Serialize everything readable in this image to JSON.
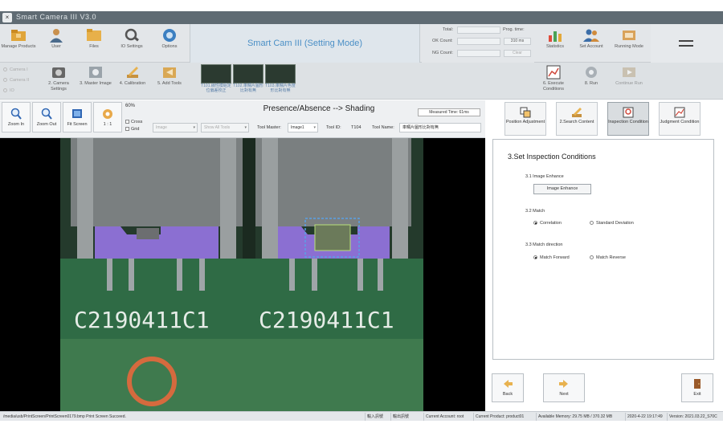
{
  "window": {
    "title": "Smart Camera III   V3.0",
    "close_glyph": "×"
  },
  "toolbar1": {
    "items": [
      {
        "label": "Manage Products",
        "icon": "folder-icon"
      },
      {
        "label": "User",
        "icon": "user-icon"
      },
      {
        "label": "Files",
        "icon": "files-folder-icon"
      },
      {
        "label": "IO Settings",
        "icon": "io-settings-icon"
      },
      {
        "label": "Options",
        "icon": "options-icon"
      }
    ],
    "mode_title": "Smart Cam III   (Setting Mode)",
    "total_label": "Total:",
    "ok_label": "OK Count:",
    "ng_label": "NG Count:",
    "prog_time_label": "Prog. time:",
    "prog_time_value": "310 ms",
    "clear_label": "Clear",
    "right_items": [
      {
        "label": "Statistics",
        "icon": "statistics-icon"
      },
      {
        "label": "Set Account",
        "icon": "set-account-icon"
      },
      {
        "label": "Running Mode",
        "icon": "running-mode-icon"
      }
    ]
  },
  "toolbar2": {
    "cameras": [
      "Camera I",
      "Camera II",
      "IO"
    ],
    "items": [
      {
        "label": "2. Camera Settings",
        "icon": "camera-icon"
      },
      {
        "label": "3. Master Image",
        "icon": "master-image-icon"
      },
      {
        "label": "4. Calibration",
        "icon": "calibration-icon"
      },
      {
        "label": "5. Add Tools",
        "icon": "add-tools-icon"
      }
    ],
    "thumbnails": [
      {
        "label": "T101.線性模組定位偏差校正"
      },
      {
        "label": "T102.車輛片圖形比對有無"
      },
      {
        "label": "T103.車輛片色度形比對有無"
      }
    ],
    "right_items": [
      {
        "label": "6. Execute Conditions",
        "icon": "execute-conditions-icon"
      },
      {
        "label": "8. Run",
        "icon": "run-icon"
      },
      {
        "label": "Continue Run",
        "icon": "continue-run-icon"
      }
    ]
  },
  "viewbar": {
    "zoom_in": "Zoom In",
    "zoom_out": "Zoom Out",
    "fit_screen": "Fit Screen",
    "one_to_one": "1 : 1",
    "zoom_pct": "60%",
    "cross": "Cross",
    "grid": "Grid",
    "title": "Presence/Absence --> Shading",
    "measured_time": "Measured Time: 61ms",
    "image_select": "Image",
    "show_all_select": "Show All Tools",
    "tool_master_label": "Tool Master:",
    "tool_master_value": "Image1",
    "tool_id_label": "Tool ID:",
    "tool_id_value": "T104",
    "tool_name_label": "Tool Name:",
    "tool_name_value": "車輛片圖形比對有無"
  },
  "image": {
    "pcb_text_left": "C2190411C1",
    "pcb_text_right": "C2190411C1"
  },
  "steps": [
    {
      "label": "Position Adjustment",
      "icon": "position-adjustment-icon"
    },
    {
      "label": "2.Search Content",
      "icon": "search-content-icon"
    },
    {
      "label": "Inspection Condition",
      "icon": "inspection-condition-icon"
    },
    {
      "label": "Judgment Condition",
      "icon": "judgment-condition-icon"
    }
  ],
  "panel": {
    "heading": "3.Set Inspection Conditions",
    "image_enhance_label": "3.1 Image Enhance",
    "image_enhance_button": "Image Enhance",
    "match_label": "3.2 Match",
    "match_options": [
      "Correlation",
      "Standard Deviation"
    ],
    "match_selected": 0,
    "direction_label": "3.3 Match direction",
    "direction_options": [
      "Match Forward",
      "Match Reverse"
    ],
    "direction_selected": 0
  },
  "nav": {
    "back": "Back",
    "next": "Next",
    "exit": "Exit"
  },
  "status": {
    "path": "/media/usb/PrintScreen/PrintScreen0179.bmp  Print Screen Succeed.",
    "io1": "輸入訊號",
    "io2": "輸出訊號",
    "account": "Current Account: root",
    "product": "Current Product: product01",
    "memory": "Available Memory: 29.75 MB / 370.32 MB",
    "datetime": "2020-4-22 19:17:49",
    "version": "Version: 2021.03.22_S70C"
  },
  "colors": {
    "accent": "#4a8fc6",
    "highlight_purple": "#8b6fd2",
    "pcb_green": "#2f6b45",
    "roi_blue": "#5aa0e6"
  }
}
